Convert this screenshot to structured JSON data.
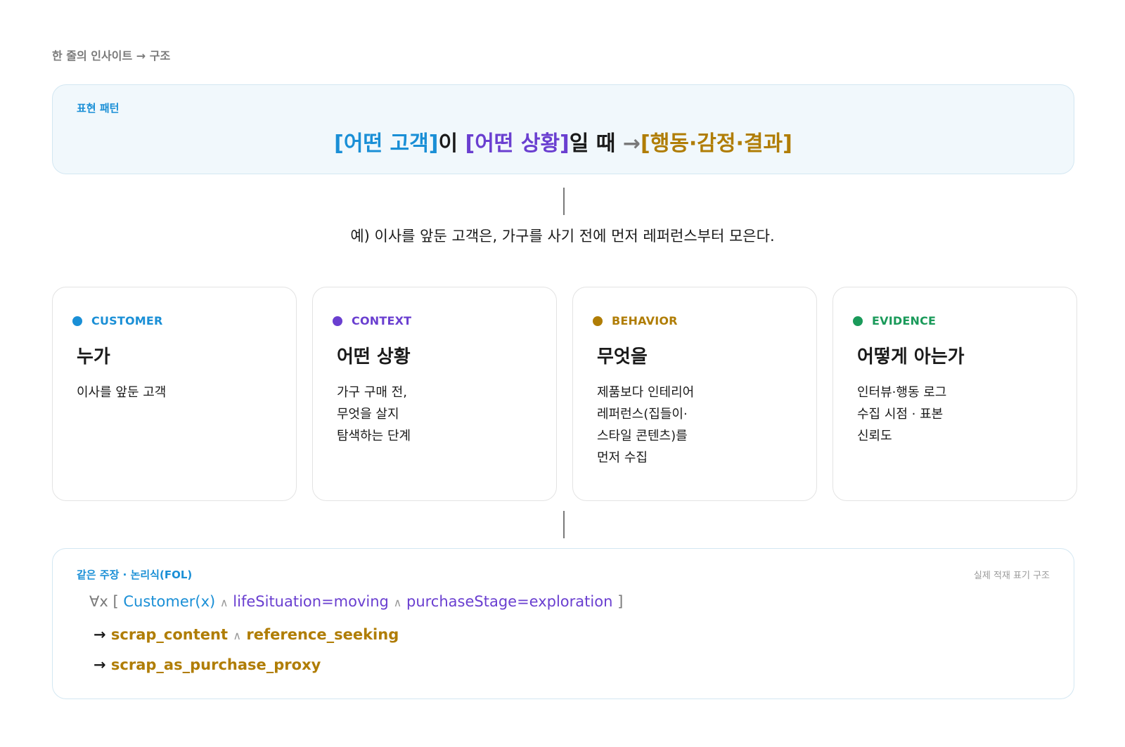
{
  "breadcrumb": "한 줄의 인사이트 → 구조",
  "pattern": {
    "label": "표현 패턴",
    "customer": "[어떤 고객]",
    "particle1": "이 ",
    "situation": "[어떤 상황]",
    "particle2": "일 때 ",
    "arrow": "→",
    "result": "[행동·감정·결과]"
  },
  "example": "예) 이사를 앞둔 고객은, 가구를 사기 전에 먼저 레퍼런스부터 모은다.",
  "cards": [
    {
      "tag": "CUSTOMER",
      "title": "누가",
      "lines": [
        "이사를 앞둔 고객"
      ],
      "color": "#1a8fd6"
    },
    {
      "tag": "CONTEXT",
      "title": "어떤 상황",
      "lines": [
        "가구 구매 전,",
        "무엇을 살지",
        "탐색하는 단계"
      ],
      "color": "#6a3fd0"
    },
    {
      "tag": "BEHAVIOR",
      "title": "무엇을",
      "lines": [
        "제품보다 인테리어",
        "레퍼런스(집들이·",
        "스타일 콘텐츠)를",
        "먼저 수집"
      ],
      "color": "#b07d05"
    },
    {
      "tag": "EVIDENCE",
      "title": "어떻게 아는가",
      "lines": [
        "인터뷰·행동 로그",
        "수집 시점 · 표본",
        "신뢰도"
      ],
      "color": "#1a9a5a"
    }
  ],
  "fol": {
    "label": "같은 주장 · 논리식(FOL)",
    "note": "실제 적재 표기 구조",
    "forall": "∀x",
    "open_bracket": "[",
    "term1": "Customer(x)",
    "and": "∧",
    "term2": "lifeSituation=moving",
    "term3": "purchaseStage=exploration",
    "close_bracket": "]",
    "arrow": "→",
    "result1a": "scrap_content",
    "result1b": "reference_seeking",
    "result2": "scrap_as_purchase_proxy"
  }
}
